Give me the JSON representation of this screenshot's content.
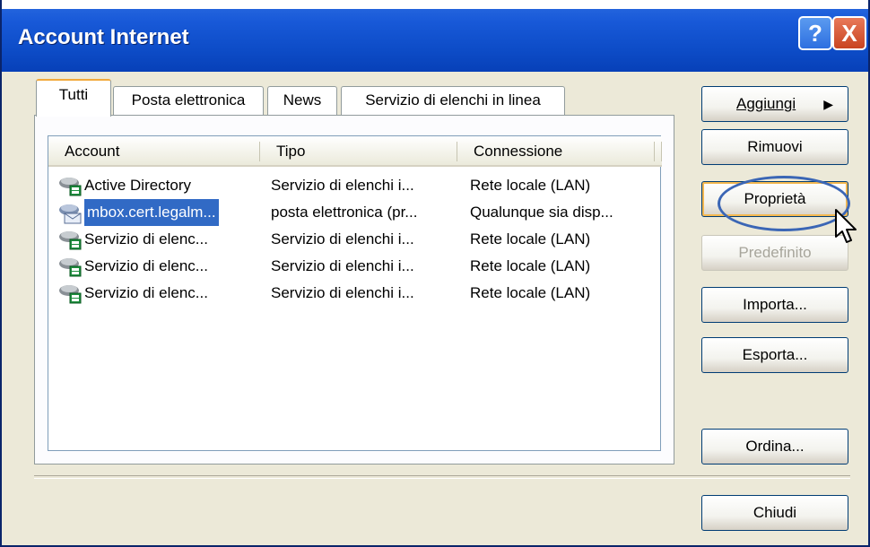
{
  "window": {
    "title": "Account Internet",
    "help_label": "?",
    "close_label": "X"
  },
  "tabs": [
    {
      "label": "Tutti",
      "active": true
    },
    {
      "label": "Posta elettronica",
      "active": false
    },
    {
      "label": "News",
      "active": false
    },
    {
      "label": "Servizio di elenchi in linea",
      "active": false
    }
  ],
  "list": {
    "columns": [
      "Account",
      "Tipo",
      "Connessione"
    ],
    "rows": [
      {
        "account": "Active Directory",
        "tipo": "Servizio di elenchi i...",
        "connessione": "Rete locale (LAN)",
        "icon": "directory-service-icon",
        "selected": false
      },
      {
        "account": "mbox.cert.legalm...",
        "tipo": "posta elettronica (pr...",
        "connessione": "Qualunque sia disp...",
        "icon": "mail-account-icon",
        "selected": true
      },
      {
        "account": "Servizio di elenc...",
        "tipo": "Servizio di elenchi i...",
        "connessione": "Rete locale (LAN)",
        "icon": "directory-service-icon",
        "selected": false
      },
      {
        "account": "Servizio di elenc...",
        "tipo": "Servizio di elenchi i...",
        "connessione": "Rete locale (LAN)",
        "icon": "directory-service-icon",
        "selected": false
      },
      {
        "account": "Servizio di elenc...",
        "tipo": "Servizio di elenchi i...",
        "connessione": "Rete locale (LAN)",
        "icon": "directory-service-icon",
        "selected": false
      }
    ]
  },
  "buttons": {
    "aggiungi": "Aggiungi",
    "rimuovi": "Rimuovi",
    "proprieta": "Proprietà",
    "predefinito": "Predefinito",
    "importa": "Importa...",
    "esporta": "Esporta...",
    "ordina": "Ordina...",
    "chiudi": "Chiudi"
  },
  "colors": {
    "titlebar": "#0d4cc7",
    "selection": "#316ac5",
    "highlight_circle": "#3b66b5"
  }
}
